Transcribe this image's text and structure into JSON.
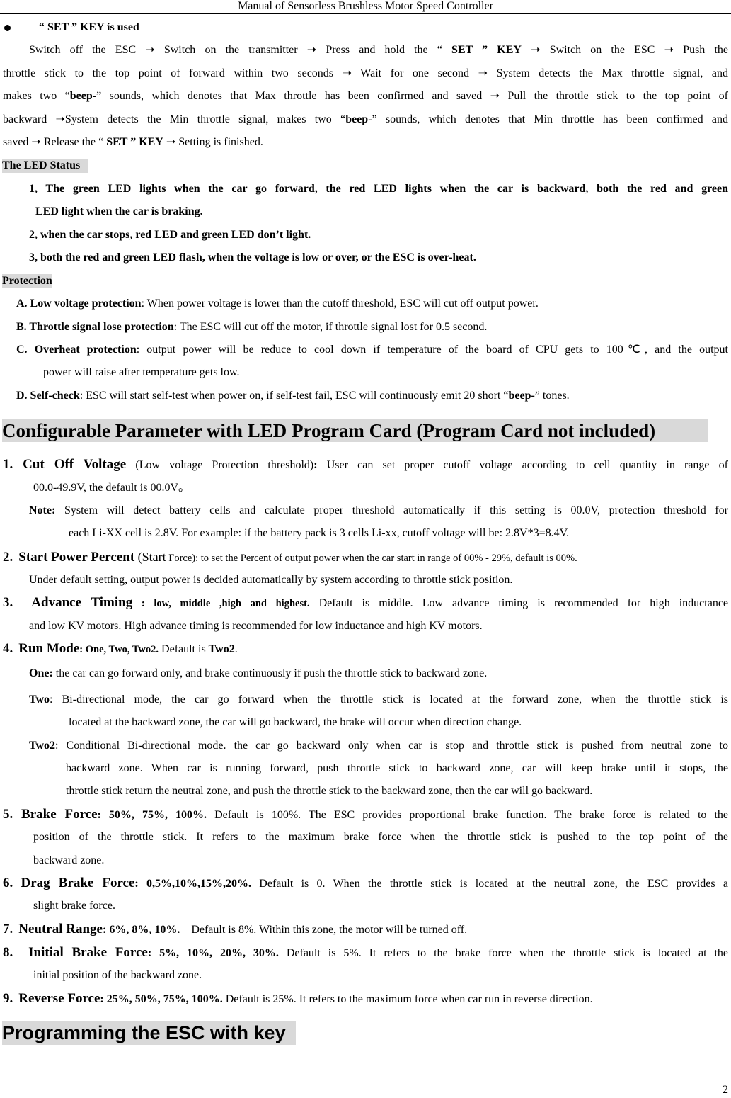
{
  "header": {
    "title": "Manual of Sensorless Brushless Motor Speed Controller"
  },
  "page_number": "2",
  "set_key": {
    "heading": "“ SET ” KEY is used",
    "lines": [
      [
        "Switch off the ESC ➝ Switch on the transmitter ➝ Press and hold the “ ",
        "SET ” KEY",
        " ➝ Switch on the ESC ➝ Push the"
      ],
      [
        "throttle stick to the top point of forward within two seconds ➝ Wait for one second ➝ System detects the Max throttle signal, and"
      ],
      [
        "makes two “",
        "beep-",
        "” sounds, which denotes that Max throttle has been confirmed and saved ➝ Pull the throttle stick to the top point of"
      ],
      [
        "backward ➝System detects the Min throttle signal, makes two “",
        "beep-",
        "” sounds, which denotes that Min throttle has been confirmed and"
      ],
      [
        "saved ➝ Release the “ ",
        "SET ” KEY",
        " ➝ Setting is finished."
      ]
    ]
  },
  "led_status": {
    "heading": "The LED Status",
    "items": [
      "1, The green LED lights when the car go forward, the red LED lights when the car is backward, both the red and green",
      "LED light when the car is braking.",
      "2, when the car stops, red LED and green LED don’t light.",
      "3, both the red and green LED flash, when the voltage is low or over, or the ESC is over-heat."
    ]
  },
  "protection": {
    "heading": "Protection",
    "items": [
      {
        "label": "A. Low voltage protection",
        "text": ": When power voltage is lower than the cutoff threshold, ESC will cut off output power."
      },
      {
        "label": "B. Throttle signal lose protection",
        "text": ": The ESC will cut off the motor, if throttle signal lost for 0.5 second."
      },
      {
        "label": "C. Overheat protection",
        "text": ": output power will be reduce to cool down if temperature of the board of CPU gets to 100℃, and the output",
        "cont": "power will raise after temperature gets low."
      },
      {
        "label": "D. Self-check",
        "text": ": ESC will start self-test when power on, if self-test fail, ESC will continuously emit 20 short “",
        "bold2": "beep-",
        "text2": "” tones."
      }
    ]
  },
  "config": {
    "heading": "Configurable Parameter with LED Program Card (Program Card not included)",
    "p1": {
      "num": "1. Cut Off Voltage",
      "paren": " (Low voltage Protection threshold)",
      "colon": ":",
      "text": " User can set proper cutoff voltage according to cell quantity in range of",
      "cont": "00.0-49.9V, the default is 00.0V。",
      "note_label": "Note:",
      "note": " System will detect battery cells and calculate proper threshold automatically if this setting is 00.0V, protection threshold for",
      "note_cont": "each Li-XX cell is 2.8V. For example: if the battery pack is 3 cells Li-xx, cutoff voltage will be: 2.8V*3=8.4V."
    },
    "p2": {
      "num": "2.",
      "title": "Start Power Percent",
      "paren": " (Start",
      "text": " Force): to set the Percent of output power when the car start in range of 00% - 29%, default is 00%.",
      "cont": "Under default setting, output power is decided automatically by system according to throttle stick position."
    },
    "p3": {
      "num": "3.",
      "title": "Advance Timing",
      "options": " : low, middle ,high and highest.",
      "text": " Default is middle. Low advance timing is recommended for high inductance",
      "cont": "and low KV motors. High advance timing is recommended for low inductance and high KV motors."
    },
    "p4": {
      "num": "4.",
      "title": "Run Mode",
      "options": ": One, Two, Two2.",
      "text": " Default is ",
      "default": "Two2",
      "end": ".",
      "modes": [
        {
          "label": "One:",
          "lines": [
            " the car can go forward only, and brake continuously if push the throttle stick to backward zone."
          ]
        },
        {
          "label": "Two",
          "lines": [
            ": Bi-directional mode, the car go forward when the throttle stick is located at the forward zone, when the throttle stick is",
            "located at the backward zone, the car will go backward, the brake will occur when direction change."
          ]
        },
        {
          "label": "Two2",
          "lines": [
            ": Conditional Bi-directional mode. the car go backward only when car is stop and throttle stick is pushed from neutral zone to",
            "backward zone. When car is running forward, push throttle stick to backward zone, car will keep brake until it stops, the",
            "throttle stick return the neutral zone, and push the throttle stick to the backward zone, then the car will go backward."
          ]
        }
      ]
    },
    "p5": {
      "title": "5. Brake Force",
      "options": ": 50%, 75%, 100%.",
      "text": " Default is 100%. The ESC provides proportional brake function. The brake force is related to the",
      "cont": [
        "position of the throttle stick. It refers to the maximum brake force when the throttle stick is pushed to the top point of the",
        "backward zone."
      ]
    },
    "p6": {
      "num": "6.",
      "title": "Drag Brake Force",
      "options": ": 0,5%,10%,15%,20%.",
      "text": " Default is 0. When the throttle stick is located at the neutral zone, the ESC provides a",
      "cont": "slight brake force."
    },
    "p7": {
      "num": "7.",
      "title": "Neutral Range",
      "options": ": 6%, 8%, 10%.",
      "text": "    Default is 8%. Within this zone, the motor will be turned off."
    },
    "p8": {
      "num": "8.",
      "title": "Initial Brake Force",
      "options": ": 5%, 10%, 20%, 30%.",
      "text": " Default is 5%. It refers to the brake force when the throttle stick is located at the",
      "cont": "initial position of the backward zone."
    },
    "p9": {
      "num": "9.",
      "title": "Reverse Force",
      "options": ": 25%, 50%, 75%, 100%.",
      "text": " Default is 25%. It refers to the maximum force when car run in reverse direction."
    }
  },
  "programming": {
    "heading": "Programming the ESC with key"
  }
}
